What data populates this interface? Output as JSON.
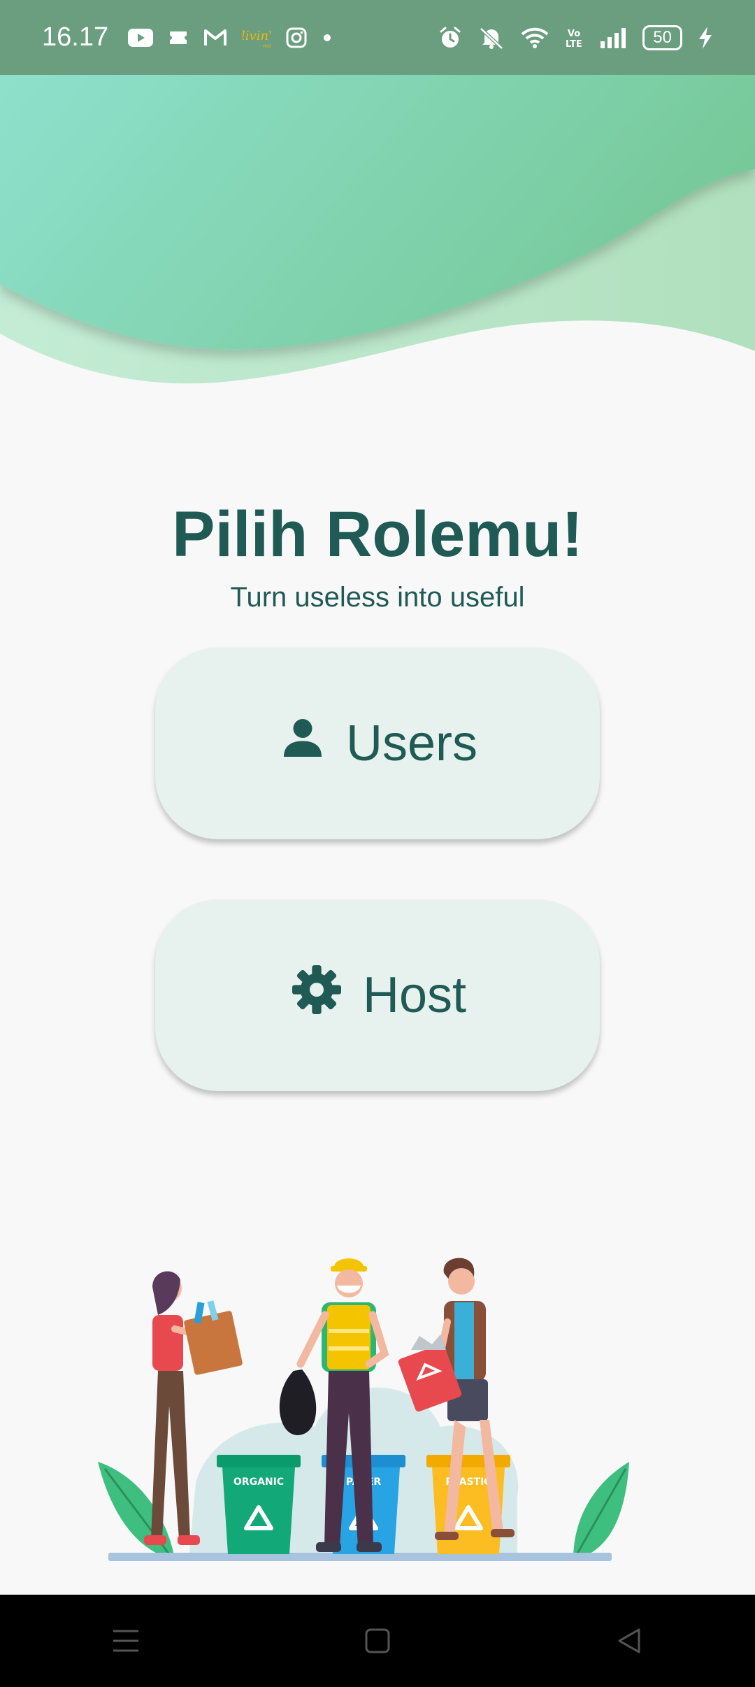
{
  "status_bar": {
    "time": "16.17",
    "battery": "50",
    "left_icons": [
      "youtube-icon",
      "ticket-icon",
      "gmail-icon",
      "livin-icon",
      "instagram-icon",
      "dot-icon"
    ],
    "right_icons": [
      "alarm-icon",
      "mute-icon",
      "wifi-icon",
      "volte-icon",
      "signal-icon",
      "charging-icon"
    ]
  },
  "main": {
    "title": "Pilih Rolemu!",
    "subtitle": "Turn useless into useful",
    "roles": [
      {
        "label": "Users",
        "icon": "person-icon"
      },
      {
        "label": "Host",
        "icon": "gear-icon"
      }
    ]
  },
  "illustration": {
    "bin_labels": [
      "ORGANIC",
      "PAPER",
      "PLASTIC"
    ]
  },
  "colors": {
    "primary": "#1f5a55",
    "button_bg": "#e7f1ee",
    "status_bar": "#6a9e7f",
    "wave_start": "#8ee0cc",
    "wave_end": "#7dcf9d"
  },
  "nav_bar": {
    "buttons": [
      "menu-icon",
      "home-icon",
      "back-icon"
    ]
  }
}
